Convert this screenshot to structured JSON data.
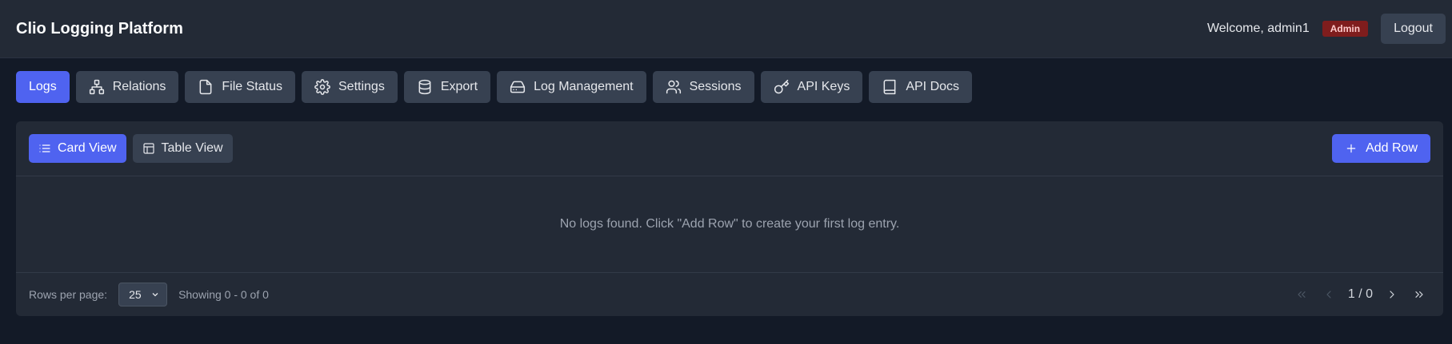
{
  "header": {
    "title": "Clio Logging Platform",
    "welcome": "Welcome, admin1",
    "role_badge": "Admin",
    "logout_label": "Logout"
  },
  "nav": {
    "tabs": [
      {
        "label": "Logs",
        "icon": "none",
        "active": true
      },
      {
        "label": "Relations",
        "icon": "sitemap-icon"
      },
      {
        "label": "File Status",
        "icon": "file-icon"
      },
      {
        "label": "Settings",
        "icon": "gear-icon"
      },
      {
        "label": "Export",
        "icon": "database-icon"
      },
      {
        "label": "Log Management",
        "icon": "hard-drive-icon"
      },
      {
        "label": "Sessions",
        "icon": "users-icon"
      },
      {
        "label": "API Keys",
        "icon": "key-icon"
      },
      {
        "label": "API Docs",
        "icon": "book-icon"
      }
    ]
  },
  "toolbar": {
    "card_view_label": "Card View",
    "table_view_label": "Table View",
    "add_row_label": "Add Row",
    "active_view": "Card View"
  },
  "content": {
    "empty_message": "No logs found. Click \"Add Row\" to create your first log entry."
  },
  "footer": {
    "rows_per_page_label": "Rows per page:",
    "rows_per_page_value": "25",
    "showing_text": "Showing 0 - 0 of 0",
    "page_indicator": "1 / 0"
  },
  "colors": {
    "accent": "#4f63f0",
    "background": "#131a27",
    "panel": "#232a36",
    "badge": "#7f1d1d"
  }
}
